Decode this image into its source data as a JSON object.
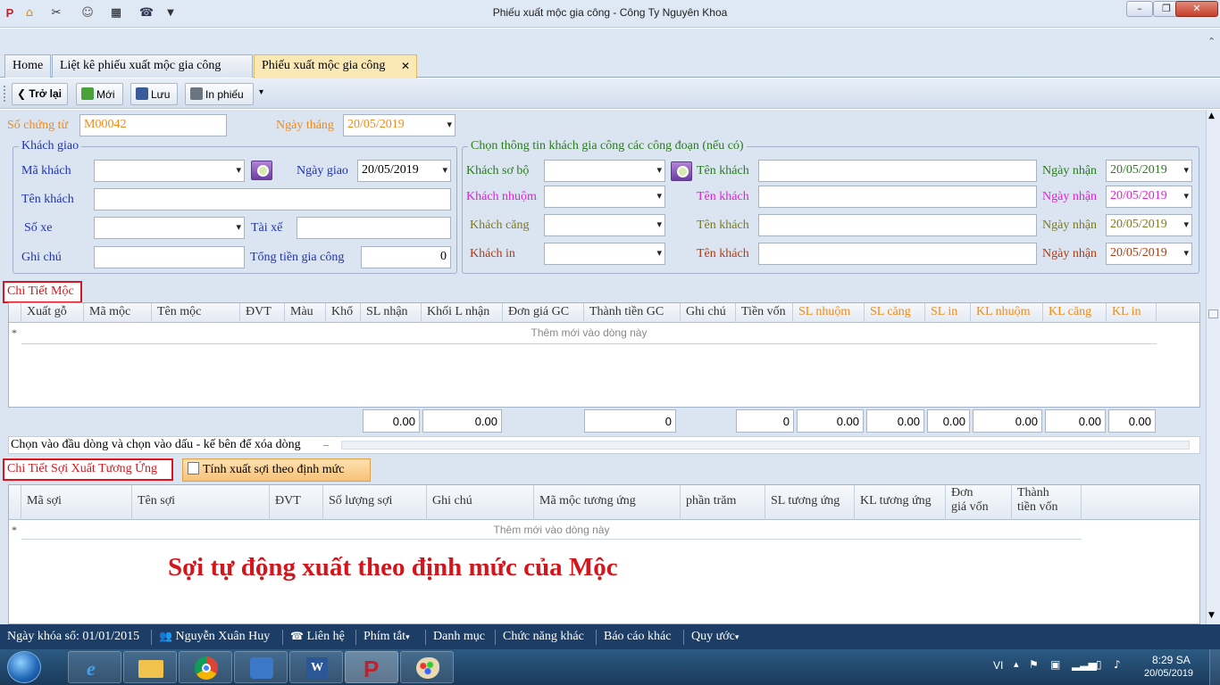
{
  "window": {
    "title": "Phiếu xuất mộc gia công - Công Ty Nguyên Khoa",
    "min": "–",
    "max": "❐",
    "close": "✕"
  },
  "tabs": [
    {
      "label": "Home"
    },
    {
      "label": "Liệt kê phiếu xuất mộc gia công"
    },
    {
      "label": "Phiếu xuất mộc gia công"
    }
  ],
  "tab_close": "✕",
  "toolbar": {
    "back": "Trở lại",
    "new": "Mới",
    "save": "Lưu",
    "print": "In phiếu"
  },
  "header": {
    "so_chung_tu_label": "Số chứng từ",
    "so_chung_tu": "M00042",
    "ngay_thang_label": "Ngày tháng",
    "ngay_thang": "20/05/2019"
  },
  "khach_giao": {
    "title": "Khách giao",
    "ma_khach_label": "Mã khách",
    "ma_khach": "",
    "ngay_giao_label": "Ngày giao",
    "ngay_giao": "20/05/2019",
    "ten_khach_label": "Tên khách",
    "ten_khach": "",
    "so_xe_label": "Số xe",
    "so_xe": "",
    "tai_xe_label": "Tài xế",
    "tai_xe": "",
    "ghi_chu_label": "Ghi chú",
    "ghi_chu": "",
    "tong_tien_label": "Tổng tiền gia công",
    "tong_tien": "0"
  },
  "gia_cong": {
    "title": "Chọn thông  tin khách gia công các công đoạn (nếu có)",
    "ten_khach_label": "Tên khách",
    "ngay_nhan_label": "Ngày nhận",
    "rows": [
      {
        "label": "Khách sơ bộ",
        "value": "",
        "ten": "",
        "ngay": "20/05/2019",
        "color": "#2a7a1e"
      },
      {
        "label": "Khách nhuộm",
        "value": "",
        "ten": "",
        "ngay": "20/05/2019",
        "color": "#e020d8"
      },
      {
        "label": "Khách căng",
        "value": "",
        "ten": "",
        "ngay": "20/05/2019",
        "color": "#7a7a1e"
      },
      {
        "label": "Khách in",
        "value": "",
        "ten": "",
        "ngay": "20/05/2019",
        "color": "#b23a12"
      }
    ]
  },
  "chi_tiet_moc": {
    "title": "Chi Tiết Mộc",
    "new_row": "Thêm mới vào dòng này",
    "row_marker": "*",
    "columns": [
      "Xuất gỗ",
      "Mã mộc",
      "Tên mộc",
      "ĐVT",
      "Màu",
      "Khổ",
      "SL nhận",
      "Khối L nhận",
      "Đơn giá GC",
      "Thành tiền GC",
      "Ghi chú",
      "Tiền vốn",
      "SL nhuộm",
      "SL căng",
      "SL in",
      "KL nhuộm",
      "KL căng",
      "KL in"
    ],
    "totals": {
      "sl_nhan": "0.00",
      "khoi_l_nhan": "0.00",
      "thanh_tien_gc": "0",
      "tien_von": "0",
      "sl_nhuom": "0.00",
      "sl_cang": "0.00",
      "sl_in": "0.00",
      "kl_nhuom": "0.00",
      "kl_cang": "0.00",
      "kl_in": "0.00"
    },
    "hint": "Chọn vào đầu dòng và chọn vào dấu - kế bên để xóa dòng",
    "hint_minus": "–"
  },
  "chi_tiet_soi": {
    "title": "Chi Tiết Sợi Xuất Tương Ứng",
    "calc_button": "Tính xuất sợi theo định mức",
    "new_row": "Thêm mới vào dòng này",
    "row_marker": "*",
    "columns": [
      "Mã sợi",
      "Tên sợi",
      "ĐVT",
      "Số lượng sợi",
      "Ghi chú",
      "Mã mộc tương ứng",
      "phần trăm",
      "SL tương ứng",
      "KL tương ứng",
      "Đơn giá vốn",
      "Thành tiền vốn"
    ]
  },
  "annotation": "Sợi tự động xuất theo định mức của Mộc",
  "status": {
    "ngay_khoa_so": "Ngày khóa sổ: 01/01/2015",
    "user": "Nguyễn Xuân Huy",
    "lien_he": "Liên hệ",
    "phim_tat": "Phím tắt",
    "danh_muc": "Danh mục",
    "chuc_nang": "Chức năng khác",
    "bao_cao": "Báo cáo khác",
    "quy_uoc": "Quy ước"
  },
  "taskbar": {
    "lang": "VI",
    "time": "8:29 SA",
    "date": "20/05/2019"
  },
  "colors": {
    "accent_orange": "#f08a18",
    "red": "#d4161c",
    "blue_label": "#1f33b4"
  }
}
